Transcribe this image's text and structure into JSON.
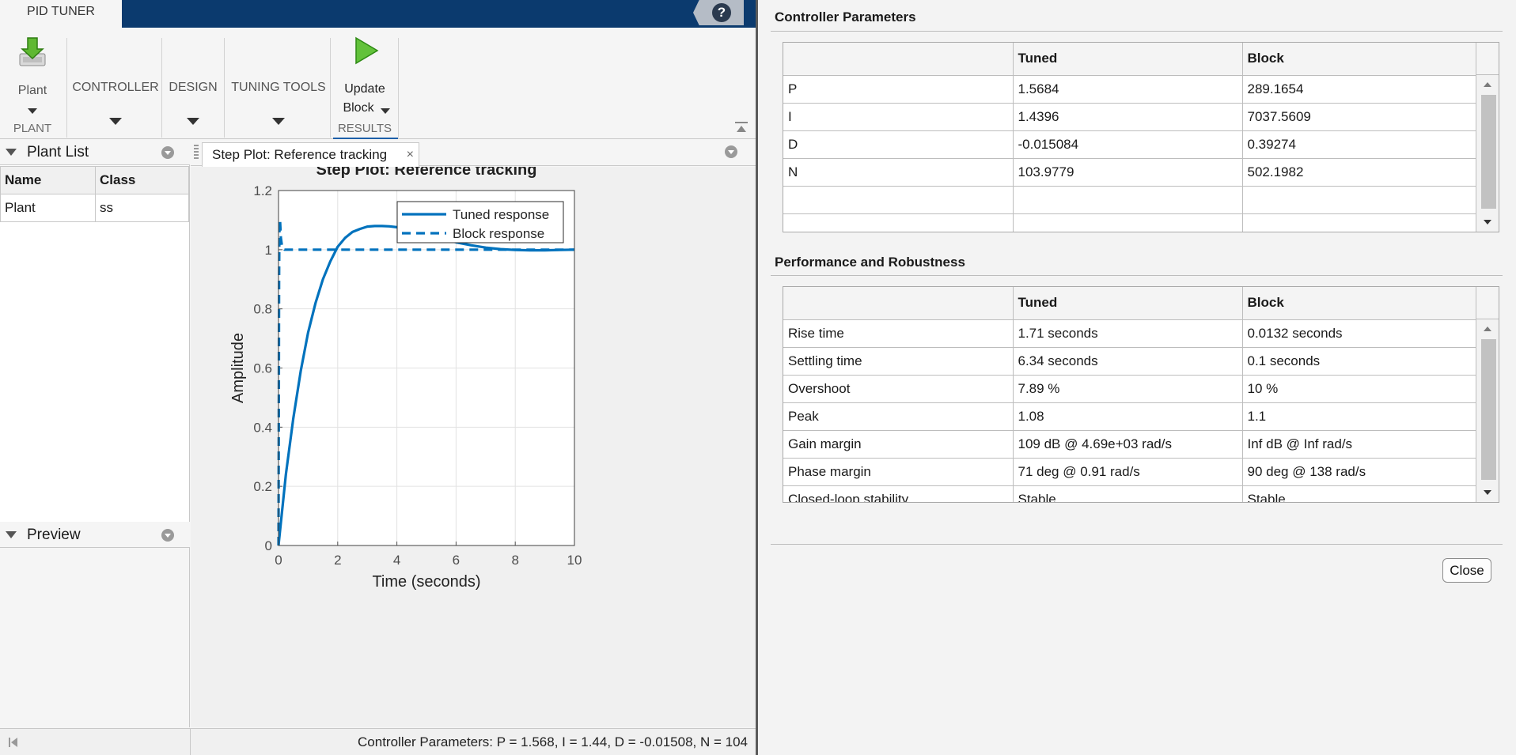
{
  "app": {
    "tab_label": "PID TUNER",
    "help_label": "?"
  },
  "ribbon": {
    "plant_button": "Plant",
    "plant_section": "PLANT",
    "controller_label": "CONTROLLER",
    "design_label": "DESIGN",
    "tuning_tools_label": "TUNING TOOLS",
    "update_line1": "Update",
    "update_line2": "Block",
    "results_section": "RESULTS"
  },
  "plant_list": {
    "title": "Plant List",
    "columns": [
      "Name",
      "Class"
    ],
    "rows": [
      [
        "Plant",
        "ss"
      ]
    ]
  },
  "preview": {
    "title": "Preview"
  },
  "document": {
    "tab_label": "Step Plot: Reference tracking",
    "close_glyph": "×"
  },
  "status": {
    "text": "Controller Parameters: P = 1.568, I = 1.44, D = -0.01508, N = 104"
  },
  "chart_data": {
    "type": "line",
    "title": "Step Plot: Reference tracking",
    "xlabel": "Time (seconds)",
    "ylabel": "Amplitude",
    "xlim": [
      0,
      10
    ],
    "ylim": [
      0,
      1.2
    ],
    "xticks": [
      "0",
      "2",
      "4",
      "6",
      "8",
      "10"
    ],
    "yticks": [
      "0",
      "0.2",
      "0.4",
      "0.6",
      "0.8",
      "1",
      "1.2"
    ],
    "grid": true,
    "legend_position": "top-right",
    "series": [
      {
        "name": "Tuned response",
        "style": "solid",
        "color": "#0072BD",
        "x": [
          0,
          0.25,
          0.5,
          0.75,
          1.0,
          1.25,
          1.5,
          1.75,
          2.0,
          2.25,
          2.5,
          2.75,
          3.0,
          3.25,
          3.5,
          3.75,
          4.0,
          4.5,
          5.0,
          5.5,
          6.0,
          6.5,
          7.0,
          7.5,
          8.0,
          8.5,
          9.0,
          9.5,
          10.0
        ],
        "y": [
          0,
          0.24,
          0.43,
          0.59,
          0.72,
          0.82,
          0.9,
          0.96,
          1.01,
          1.04,
          1.06,
          1.07,
          1.078,
          1.08,
          1.08,
          1.079,
          1.076,
          1.066,
          1.052,
          1.038,
          1.025,
          1.015,
          1.007,
          1.002,
          0.999,
          0.998,
          0.998,
          0.999,
          1.0
        ]
      },
      {
        "name": "Block response",
        "style": "dashed",
        "color": "#0072BD",
        "x": [
          0,
          0.01,
          0.02,
          0.03,
          0.05,
          0.08,
          0.12,
          0.2,
          0.3,
          1.0,
          2.0,
          4.0,
          6.0,
          8.0,
          10.0
        ],
        "y": [
          0,
          0.5,
          0.9,
          1.06,
          1.1,
          1.04,
          1.01,
          1.0,
          1.0,
          1.0,
          1.0,
          1.0,
          1.0,
          1.0,
          1.0
        ]
      }
    ]
  },
  "dialog": {
    "controller_params": {
      "title": "Controller Parameters",
      "columns": [
        "",
        "Tuned",
        "Block"
      ],
      "rows": [
        [
          "P",
          "1.5684",
          "289.1654"
        ],
        [
          "I",
          "1.4396",
          "7037.5609"
        ],
        [
          "D",
          "-0.015084",
          "0.39274"
        ],
        [
          "N",
          "103.9779",
          "502.1982"
        ],
        [
          "",
          "",
          ""
        ],
        [
          "",
          "",
          ""
        ]
      ]
    },
    "performance": {
      "title": "Performance and Robustness",
      "columns": [
        "",
        "Tuned",
        "Block"
      ],
      "rows": [
        [
          "Rise time",
          "1.71 seconds",
          "0.0132 seconds"
        ],
        [
          "Settling time",
          "6.34 seconds",
          "0.1 seconds"
        ],
        [
          "Overshoot",
          "7.89 %",
          "10 %"
        ],
        [
          "Peak",
          "1.08",
          "1.1"
        ],
        [
          "Gain margin",
          "109 dB @ 4.69e+03 rad/s",
          "Inf dB @ Inf rad/s"
        ],
        [
          "Phase margin",
          "71 deg @ 0.91 rad/s",
          "90 deg @ 138 rad/s"
        ],
        [
          "Closed-loop stability",
          "Stable",
          "Stable"
        ]
      ]
    },
    "close_label": "Close"
  }
}
